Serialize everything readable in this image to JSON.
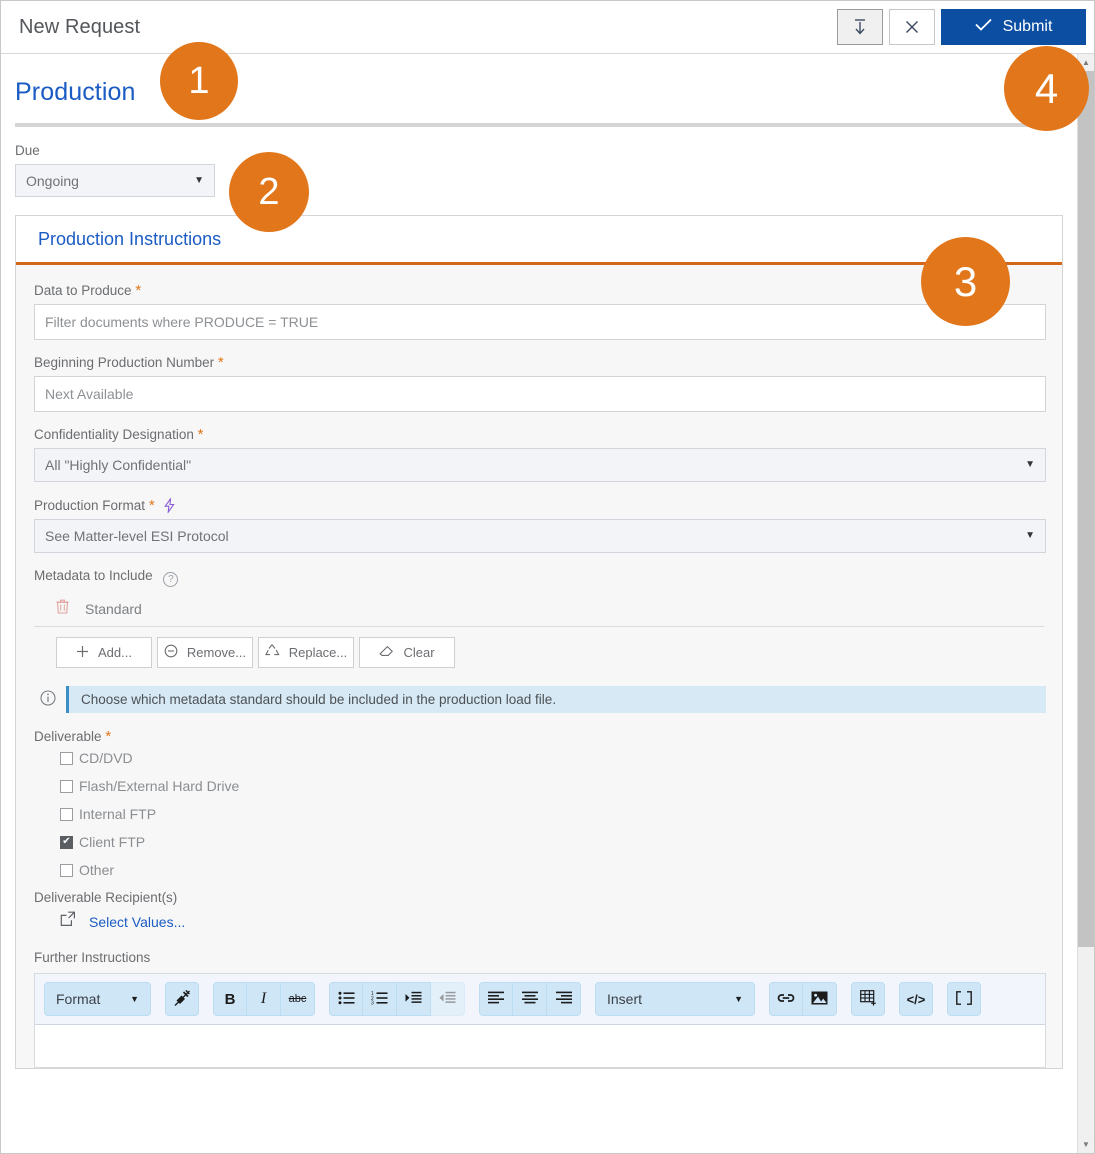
{
  "window": {
    "title": "New Request"
  },
  "titlebar": {
    "save_icon": "save-download-icon",
    "close_icon": "close-icon",
    "submit_label": "Submit",
    "submit_check_icon": "check-icon",
    "submit_color": "#0b4ea2"
  },
  "section": {
    "title": "Production"
  },
  "due": {
    "label": "Due",
    "value": "Ongoing",
    "caret_icon": "chevron-down-icon"
  },
  "panel": {
    "title": "Production Instructions",
    "accent_color": "#d4661c",
    "fields": {
      "data_to_produce": {
        "label": "Data to Produce",
        "required": "*",
        "value": "Filter documents where PRODUCE = TRUE"
      },
      "beginning_production_number": {
        "label": "Beginning Production Number",
        "required": "*",
        "value": "Next Available"
      },
      "confidentiality_designation": {
        "label": "Confidentiality Designation",
        "required": "*",
        "value": "All \"Highly Confidential\""
      },
      "production_format": {
        "label": "Production Format",
        "required": "*",
        "bolt_icon": "lightning-bolt-icon",
        "value": "See Matter-level ESI Protocol"
      },
      "metadata_to_include": {
        "label": "Metadata to Include",
        "help_icon": "question-mark-icon",
        "items": [
          {
            "delete_icon": "trash-icon",
            "name": "Standard"
          }
        ],
        "buttons": [
          {
            "icon": "plus-icon",
            "label": "Add..."
          },
          {
            "icon": "minus-icon",
            "label": "Remove..."
          },
          {
            "icon": "recycle-icon",
            "label": "Replace..."
          },
          {
            "icon": "eraser-icon",
            "label": "Clear"
          }
        ]
      },
      "info_banner": {
        "icon": "info-circle-icon",
        "text": "Choose which metadata standard should be included in the production load file.",
        "background": "#d6e9f5",
        "accent": "#3a8fc4"
      },
      "deliverable": {
        "label": "Deliverable",
        "required": "*",
        "options": [
          {
            "label": "CD/DVD",
            "checked": false
          },
          {
            "label": "Flash/External Hard Drive",
            "checked": false
          },
          {
            "label": "Internal FTP",
            "checked": false
          },
          {
            "label": "Client FTP",
            "checked": true
          },
          {
            "label": "Other",
            "checked": false
          }
        ]
      },
      "deliverable_recipients": {
        "label": "Deliverable Recipient(s)",
        "link_icon": "external-link-icon",
        "link_label": "Select Values..."
      },
      "further_instructions": {
        "label": "Further Instructions",
        "toolbar": {
          "format_select": {
            "value": "Format",
            "caret_icon": "chevron-down-icon"
          },
          "remove_format": {
            "icon": "remove-format-icon"
          },
          "bold": {
            "icon": "bold-icon",
            "glyph": "B"
          },
          "italic": {
            "icon": "italic-icon",
            "glyph": "I"
          },
          "strikethrough": {
            "icon": "strikethrough-icon",
            "glyph": "abc"
          },
          "bullet_list": {
            "icon": "bulleted-list-icon"
          },
          "numbered_list": {
            "icon": "numbered-list-icon"
          },
          "indent": {
            "icon": "increase-indent-icon"
          },
          "outdent": {
            "icon": "decrease-indent-icon",
            "disabled": true
          },
          "align_left": {
            "icon": "align-left-icon"
          },
          "align_center": {
            "icon": "align-center-icon"
          },
          "align_right": {
            "icon": "align-right-icon"
          },
          "insert_select": {
            "value": "Insert",
            "caret_icon": "chevron-down-icon"
          },
          "link": {
            "icon": "link-icon"
          },
          "image": {
            "icon": "image-icon"
          },
          "table": {
            "icon": "table-icon"
          },
          "source": {
            "icon": "source-code-icon"
          },
          "fullscreen": {
            "icon": "fullscreen-icon"
          }
        },
        "content": ""
      }
    }
  },
  "scrollbar": {
    "up_icon": "scroll-up-icon",
    "down_icon": "scroll-down-icon"
  },
  "callouts": {
    "color": "#e2761b",
    "items": [
      {
        "number": "1"
      },
      {
        "number": "2"
      },
      {
        "number": "3"
      },
      {
        "number": "4"
      }
    ]
  }
}
